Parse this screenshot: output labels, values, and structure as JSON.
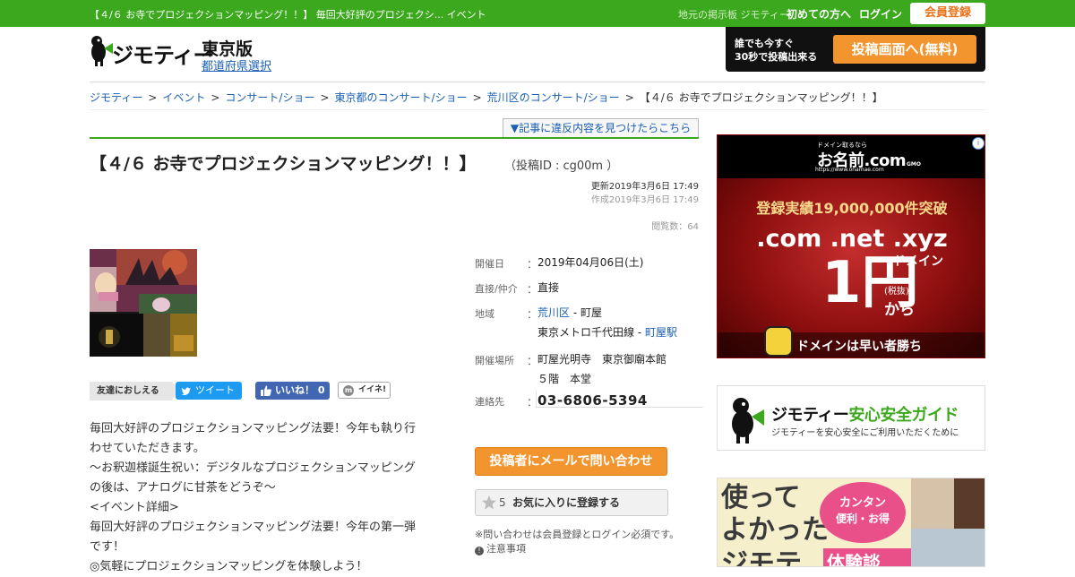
{
  "topbar": {
    "title": "【４/６ お寺でプロジェクションマッピング！！】 毎回大好評のプロジェクシ... イベント",
    "sub": "地元の掲示板 ジモティー",
    "first_time": "初めての方へ",
    "login": "ログイン",
    "register": "会員登録"
  },
  "header": {
    "logo_text": "ジモティー",
    "edition": "東京版",
    "pref_link": "都道府県選択",
    "post_line1": "誰でも今すぐ",
    "post_line2": "30秒で投稿出来る",
    "post_button": "投稿画面へ(無料)"
  },
  "breadcrumb": {
    "items": [
      "ジモティー",
      "イベント",
      "コンサート/ショー",
      "東京都のコンサート/ショー",
      "荒川区のコンサート/ショー"
    ],
    "current": "【４/６ お寺でプロジェクションマッピング！！】",
    "sep": ">"
  },
  "post": {
    "report": "▼記事に違反内容を見つけたらこちら",
    "title": "【４/６ お寺でプロジェクションマッピング！！】",
    "post_id": "（投稿ID : cg00m ）",
    "updated": "更新2019年3月6日 17:49",
    "created": "作成2019年3月6日 17:49",
    "views": "閲覧数：64"
  },
  "share": {
    "label": "友達におしえる",
    "tweet": "ツイート",
    "like": "いいね！ 0",
    "iine": "イイネ!"
  },
  "description": [
    "毎回大好評のプロジェクションマッピング法要！今年も執り行",
    "わせていただきます。",
    "～お釈迦様誕生祝い：デジタルなプロジェクションマッピング",
    "の後は、アナログに甘茶をどうぞ～",
    "<イベント詳細>",
    "毎回大好評のプロジェクションマッピング法要！今年の第一弾",
    "です！",
    "◎気軽にプロジェクションマッピングを体験しよう！"
  ],
  "details": {
    "date_label": "開催日",
    "date": "2019年04月06日(土)",
    "direct_label": "直接/仲介",
    "direct": "直接",
    "area_label": "地域",
    "area_link": "荒川区",
    "area_rest": " - 町屋",
    "line": "東京メトロ千代田線 - ",
    "station": "町屋駅",
    "venue_label": "開催場所",
    "venue1": "町屋光明寺　東京御廟本館",
    "venue2": "５階　本堂",
    "contact_label": "連絡先",
    "phone": "03-6806-5394",
    "colon": "："
  },
  "actions": {
    "mail": "投稿者にメールで問い合わせ",
    "fav_count": "5",
    "fav": "お気に入りに登録する",
    "note": "※問い合わせは会員登録とログイン必須です。",
    "caution": "注意事項"
  },
  "ad": {
    "small": "ドメイン取るなら",
    "brand": "お名前.com",
    "url": "https://www.onamae.com",
    "gmo": "GMO",
    "record": "登録実績19,000,000件突破",
    "tld": ".com .net .xyz",
    "domain": "ドメイン",
    "price": "1円",
    "tax": "(税抜)",
    "kara": "から",
    "slogan": "ドメインは早い者勝ち",
    "info": "i"
  },
  "guide": {
    "title_a": "ジモティー",
    "title_b": "安心安全ガイド",
    "sub": "ジモティーを安心安全にご利用いただくために"
  },
  "banner": {
    "line1": "使って",
    "line2": "よかった",
    "line3": "ジモテ",
    "bubble1": "カンタン",
    "bubble2": "便利・お得",
    "pink": "体験談"
  }
}
